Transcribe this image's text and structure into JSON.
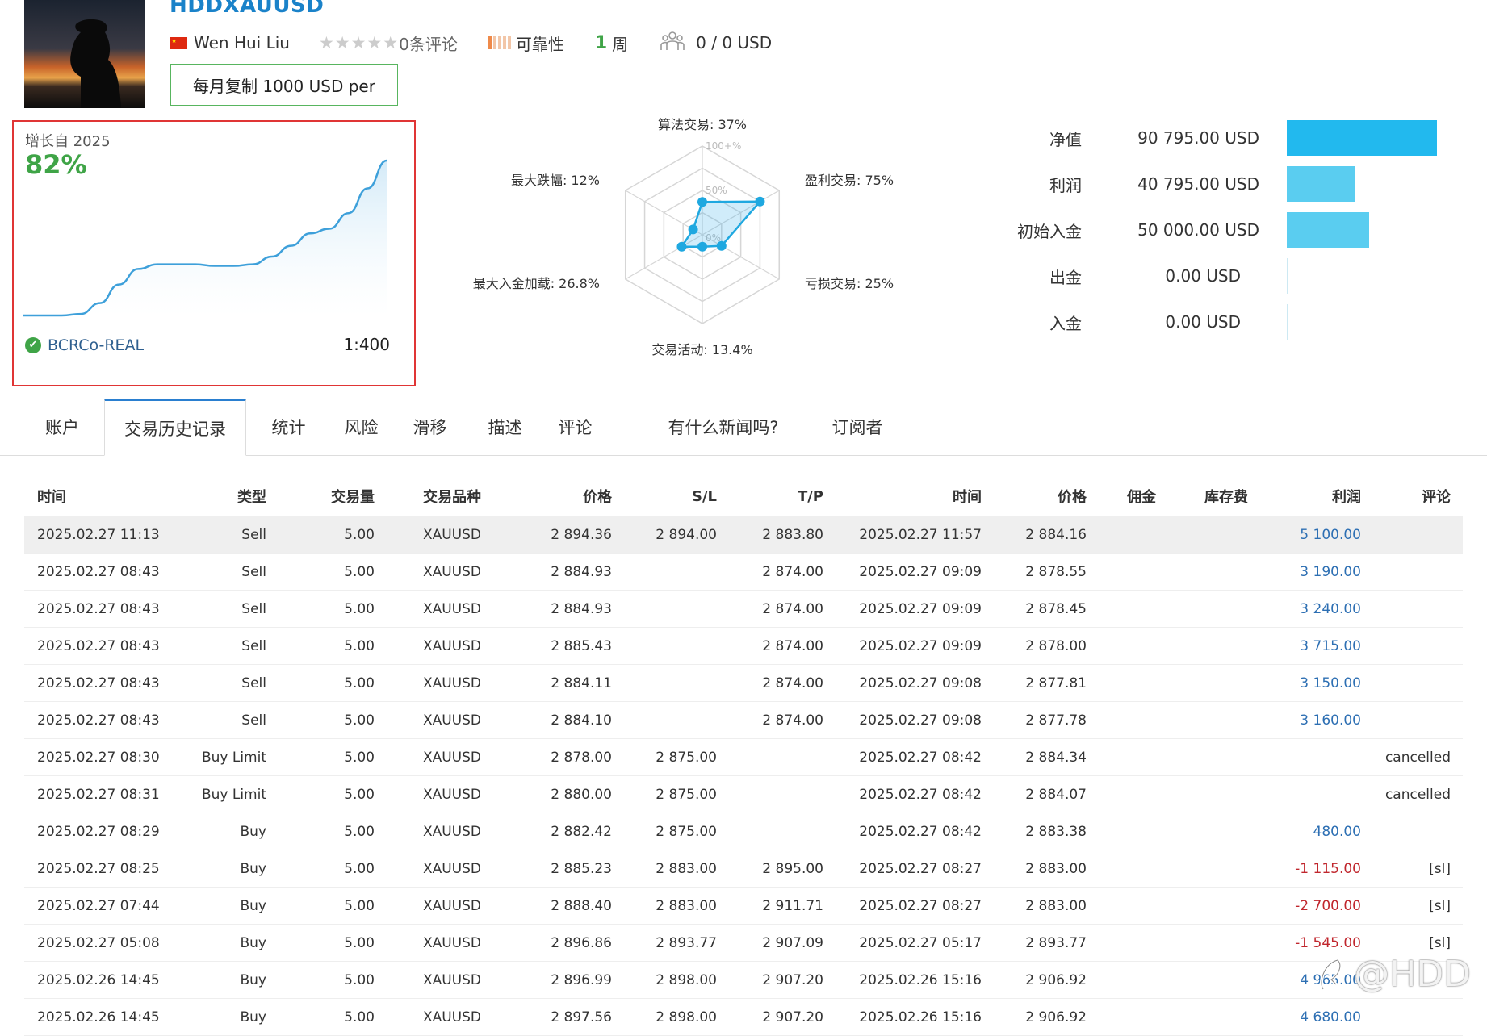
{
  "header": {
    "title": "HDDXAUUSD",
    "author": "Wen Hui Liu",
    "reviews": "0条评论",
    "reliability": "可靠性",
    "weeks_num": "1",
    "weeks_unit": "周",
    "subscribers": "0 / 0 USD",
    "copy_button": "每月复制 1000 USD per",
    "rating_stars": 0
  },
  "growth": {
    "label": "增长自 2025",
    "value": "82%",
    "broker": "BCRCo-REAL",
    "leverage": "1:400",
    "curve": [
      0.0,
      0.0,
      0.0,
      0.01,
      0.08,
      0.2,
      0.3,
      0.33,
      0.33,
      0.33,
      0.32,
      0.32,
      0.33,
      0.38,
      0.45,
      0.53,
      0.56,
      0.66,
      0.82,
      1.0
    ]
  },
  "radar": {
    "center_labels": [
      "100+%",
      "50%",
      "0%"
    ],
    "axes": [
      {
        "label": "算法交易: 37%",
        "value": 0.37
      },
      {
        "label": "盈利交易: 75%",
        "value": 0.75
      },
      {
        "label": "亏损交易: 25%",
        "value": 0.25
      },
      {
        "label": "交易活动: 13.4%",
        "value": 0.134
      },
      {
        "label": "最大入金加载: 26.8%",
        "value": 0.268
      },
      {
        "label": "最大跌幅: 12%",
        "value": 0.12
      }
    ]
  },
  "balance": {
    "max": 90795,
    "rows": [
      {
        "label": "净值",
        "value": "90 795.00 USD",
        "amount": 90795
      },
      {
        "label": "利润",
        "value": "40 795.00 USD",
        "amount": 40795
      },
      {
        "label": "初始入金",
        "value": "50 000.00 USD",
        "amount": 50000
      },
      {
        "label": "出金",
        "value": "0.00 USD",
        "amount": 0
      },
      {
        "label": "入金",
        "value": "0.00 USD",
        "amount": 0
      }
    ]
  },
  "tabs": [
    "账户",
    "交易历史记录",
    "统计",
    "风险",
    "滑移",
    "描述",
    "评论",
    "有什么新闻吗?",
    "订阅者"
  ],
  "active_tab": 1,
  "table": {
    "columns": [
      "时间",
      "类型",
      "交易量",
      "交易品种",
      "价格",
      "S/L",
      "T/P",
      "时间",
      "价格",
      "佣金",
      "库存费",
      "利润",
      "评论"
    ],
    "rows": [
      [
        "2025.02.27 11:13",
        "Sell",
        "5.00",
        "XAUUSD",
        "2 894.36",
        "2 894.00",
        "2 883.80",
        "2025.02.27 11:57",
        "2 884.16",
        "",
        "",
        "5 100.00",
        ""
      ],
      [
        "2025.02.27 08:43",
        "Sell",
        "5.00",
        "XAUUSD",
        "2 884.93",
        "",
        "2 874.00",
        "2025.02.27 09:09",
        "2 878.55",
        "",
        "",
        "3 190.00",
        ""
      ],
      [
        "2025.02.27 08:43",
        "Sell",
        "5.00",
        "XAUUSD",
        "2 884.93",
        "",
        "2 874.00",
        "2025.02.27 09:09",
        "2 878.45",
        "",
        "",
        "3 240.00",
        ""
      ],
      [
        "2025.02.27 08:43",
        "Sell",
        "5.00",
        "XAUUSD",
        "2 885.43",
        "",
        "2 874.00",
        "2025.02.27 09:09",
        "2 878.00",
        "",
        "",
        "3 715.00",
        ""
      ],
      [
        "2025.02.27 08:43",
        "Sell",
        "5.00",
        "XAUUSD",
        "2 884.11",
        "",
        "2 874.00",
        "2025.02.27 09:08",
        "2 877.81",
        "",
        "",
        "3 150.00",
        ""
      ],
      [
        "2025.02.27 08:43",
        "Sell",
        "5.00",
        "XAUUSD",
        "2 884.10",
        "",
        "2 874.00",
        "2025.02.27 09:08",
        "2 877.78",
        "",
        "",
        "3 160.00",
        ""
      ],
      [
        "2025.02.27 08:30",
        "Buy Limit",
        "5.00",
        "XAUUSD",
        "2 878.00",
        "2 875.00",
        "",
        "2025.02.27 08:42",
        "2 884.34",
        "",
        "",
        "",
        "cancelled"
      ],
      [
        "2025.02.27 08:31",
        "Buy Limit",
        "5.00",
        "XAUUSD",
        "2 880.00",
        "2 875.00",
        "",
        "2025.02.27 08:42",
        "2 884.07",
        "",
        "",
        "",
        "cancelled"
      ],
      [
        "2025.02.27 08:29",
        "Buy",
        "5.00",
        "XAUUSD",
        "2 882.42",
        "2 875.00",
        "",
        "2025.02.27 08:42",
        "2 883.38",
        "",
        "",
        "480.00",
        ""
      ],
      [
        "2025.02.27 08:25",
        "Buy",
        "5.00",
        "XAUUSD",
        "2 885.23",
        "2 883.00",
        "2 895.00",
        "2025.02.27 08:27",
        "2 883.00",
        "",
        "",
        "-1 115.00",
        "[sl]"
      ],
      [
        "2025.02.27 07:44",
        "Buy",
        "5.00",
        "XAUUSD",
        "2 888.40",
        "2 883.00",
        "2 911.71",
        "2025.02.27 08:27",
        "2 883.00",
        "",
        "",
        "-2 700.00",
        "[sl]"
      ],
      [
        "2025.02.27 05:08",
        "Buy",
        "5.00",
        "XAUUSD",
        "2 896.86",
        "2 893.77",
        "2 907.09",
        "2025.02.27 05:17",
        "2 893.77",
        "",
        "",
        "-1 545.00",
        "[sl]"
      ],
      [
        "2025.02.26 14:45",
        "Buy",
        "5.00",
        "XAUUSD",
        "2 896.99",
        "2 898.00",
        "2 907.20",
        "2025.02.26 15:16",
        "2 906.92",
        "",
        "",
        "4 965.00",
        ""
      ],
      [
        "2025.02.26 14:45",
        "Buy",
        "5.00",
        "XAUUSD",
        "2 897.56",
        "2 898.00",
        "2 907.20",
        "2025.02.26 15:16",
        "2 906.92",
        "",
        "",
        "4 680.00",
        ""
      ]
    ]
  },
  "watermark": "@HDD",
  "colors": {
    "accent": "#1a82c9",
    "positive": "#3fa447",
    "profit": "#2d6fb3",
    "loss": "#c0262d",
    "bar": "#5acdf0",
    "bar_primary": "#22b9ee",
    "highlight": "#e03535"
  }
}
